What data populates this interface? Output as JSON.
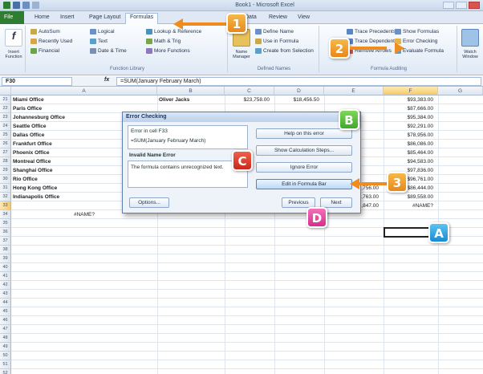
{
  "app": {
    "title": "Book1 - Microsoft Excel"
  },
  "tabs": [
    "File",
    "Home",
    "Insert",
    "Page Layout",
    "Formulas",
    "Data",
    "Review",
    "View"
  ],
  "ribbon": {
    "insert_function": "Insert Function",
    "function_library": {
      "items": [
        "AutoSum",
        "Recently Used",
        "Financial",
        "Logical",
        "Text",
        "Date & Time",
        "Lookup & Reference",
        "Math & Trig",
        "More Functions"
      ],
      "label": "Function Library"
    },
    "defined_names": {
      "name_manager": "Name Manager",
      "items": [
        "Define Name",
        "Use in Formula",
        "Create from Selection"
      ],
      "label": "Defined Names"
    },
    "formula_auditing": {
      "items": [
        "Trace Precedents",
        "Trace Dependents",
        "Remove Arrows",
        "Show Formulas",
        "Error Checking",
        "Evaluate Formula"
      ],
      "label": "Formula Auditing"
    },
    "watch_window": "Watch Window"
  },
  "formula_bar": {
    "name_box": "F30",
    "fx": "fx",
    "formula": "=SUM(January February March)"
  },
  "grid": {
    "columns": [
      "A",
      "B",
      "C",
      "D",
      "E",
      "F",
      "G"
    ],
    "rows": [
      {
        "n": "21",
        "a": "Miami Office",
        "b": "Oliver Jacks",
        "c": "$23,758.00",
        "d": "$18,456.50",
        "e": "",
        "f": "$93,383.00"
      },
      {
        "n": "22",
        "a": "Paris Office",
        "b": "",
        "c": "",
        "d": "",
        "e": "",
        "f": "$87,666.00"
      },
      {
        "n": "23",
        "a": "Johannesburg Office",
        "b": "",
        "c": "",
        "d": "",
        "e": "",
        "f": "$95,384.00"
      },
      {
        "n": "24",
        "a": "Seattle Office",
        "b": "",
        "c": "",
        "d": "",
        "e": "",
        "f": "$92,291.00"
      },
      {
        "n": "25",
        "a": "Dallas Office",
        "b": "",
        "c": "",
        "d": "",
        "e": "",
        "f": "$78,956.00"
      },
      {
        "n": "26",
        "a": "Frankfurt Office",
        "b": "",
        "c": "",
        "d": "",
        "e": "",
        "f": "$86,086.00"
      },
      {
        "n": "27",
        "a": "Phoenix Office",
        "b": "",
        "c": "",
        "d": "",
        "e": "",
        "f": "$85,464.00"
      },
      {
        "n": "28",
        "a": "Montreal Office",
        "b": "",
        "c": "",
        "d": "",
        "e": "",
        "f": "$94,583.00"
      },
      {
        "n": "29",
        "a": "Shanghai Office",
        "b": "",
        "c": "",
        "d": "",
        "e": "",
        "f": "$97,836.00"
      },
      {
        "n": "30",
        "a": "Rio Office",
        "b": "",
        "c": "",
        "d": "",
        "e": "",
        "f": "$96,761.00"
      },
      {
        "n": "31",
        "a": "Hong Kong Office",
        "b": "Ruth Bernstein",
        "c": "$33,658.00",
        "d": "",
        "e": "$38,756.00",
        "f": "$86,444.00"
      },
      {
        "n": "32",
        "a": "Indianapolis Office",
        "b": "Alana Mastrs",
        "c": "$34,658.00",
        "d": "",
        "e": "$29,763.00",
        "f": "$89,558.00"
      },
      {
        "n": "33",
        "a": "",
        "b": "",
        "c": "$790,338.00",
        "d": "$762,063.00",
        "e": "$776,847.00",
        "f": "#NAME?"
      },
      {
        "n": "34",
        "a": "#NAME?",
        "b": "",
        "c": "",
        "d": "",
        "e": "",
        "f": ""
      }
    ],
    "empty_rows": [
      "35",
      "36",
      "37",
      "38",
      "39",
      "40",
      "41",
      "42",
      "43",
      "44",
      "45",
      "46",
      "47",
      "48",
      "49",
      "50",
      "51",
      "52",
      "53"
    ]
  },
  "dialog": {
    "title": "Error Checking",
    "error_in_cell": "Error in cell F33",
    "formula": "=SUM(January February March)",
    "error_name": "Invalid Name Error",
    "description": "The formula contains unrecognized text.",
    "buttons": {
      "help": "Help on this error",
      "calc_steps": "Show Calculation Steps...",
      "ignore": "Ignore Error",
      "edit": "Edit in Formula Bar",
      "options": "Options...",
      "previous": "Previous",
      "next": "Next"
    }
  },
  "callouts": {
    "one": "1",
    "two": "2",
    "three": "3",
    "a": "A",
    "b": "B",
    "c": "C",
    "d": "D"
  }
}
